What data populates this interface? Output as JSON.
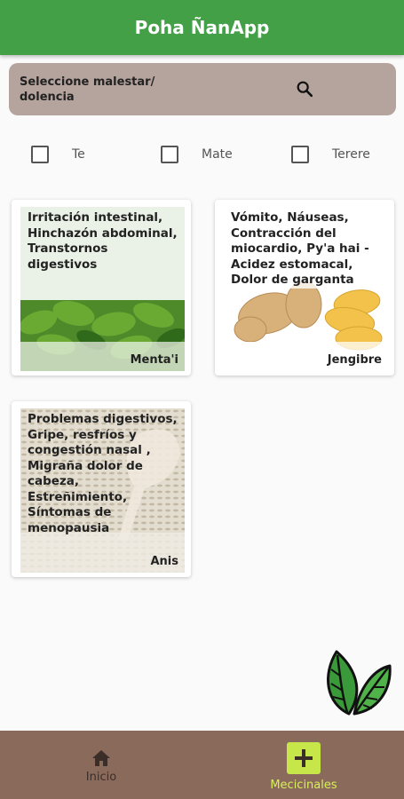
{
  "appbar": {
    "title": "Poha ÑanApp",
    "color": "#43a047"
  },
  "search": {
    "label": "Seleccione malestar/ dolencia",
    "icon": "search-icon"
  },
  "filters": [
    {
      "label": "Te",
      "checked": false
    },
    {
      "label": "Mate",
      "checked": false
    },
    {
      "label": "Terere",
      "checked": false
    }
  ],
  "cards": [
    {
      "name": "Menta'i",
      "description": "Irritación intestinal, Hinchazón abdominal, Transtornos digestivos",
      "image": "mint-leaves"
    },
    {
      "name": "Jengibre",
      "description": "Vómito, Náuseas, Contracción del miocardio, Py'a hai - Acidez estomacal, Dolor de garganta",
      "image": "ginger-root"
    },
    {
      "name": "Anis",
      "description": "Problemas digestivos, Gripe, resfríos y congestión nasal , Migraña dolor de cabeza, Estreñimiento, Síntomas de menopausia",
      "image": "anise-seeds"
    }
  ],
  "fab": {
    "icon": "leaves-icon"
  },
  "bottom_nav": {
    "items": [
      {
        "label": "Inicio",
        "icon": "home-icon",
        "active": false
      },
      {
        "label": "Mecicinales",
        "icon": "plus-icon",
        "active": true
      }
    ],
    "background": "#8a6a5b",
    "active_color": "#c6e64a"
  }
}
